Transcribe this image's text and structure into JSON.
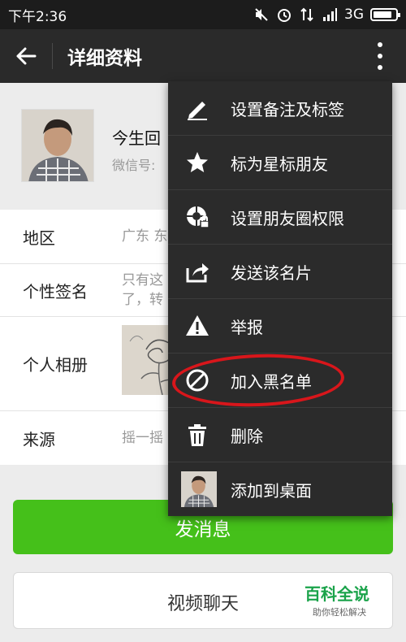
{
  "status_bar": {
    "time": "下午2:36",
    "network": "3G"
  },
  "header": {
    "title": "详细资料"
  },
  "profile": {
    "nickname": "今生回",
    "wechat_id_label": "微信号:"
  },
  "info": [
    {
      "label": "地区",
      "value": "广东  东"
    },
    {
      "label": "个性签名",
      "value_line1": "只有这",
      "value_line2": "了，转"
    },
    {
      "label": "个人相册"
    },
    {
      "label": "来源",
      "value": "摇一摇"
    }
  ],
  "buttons": {
    "send_message": "发消息",
    "video_call": "视频聊天"
  },
  "watermark": {
    "title": "百科全说",
    "subtitle": "助你轻松解决"
  },
  "menu": {
    "items": [
      {
        "label": "设置备注及标签",
        "icon": "pencil-icon"
      },
      {
        "label": "标为星标朋友",
        "icon": "star-icon"
      },
      {
        "label": "设置朋友圈权限",
        "icon": "camera-lock-icon"
      },
      {
        "label": "发送该名片",
        "icon": "share-icon"
      },
      {
        "label": "举报",
        "icon": "warning-icon"
      },
      {
        "label": "加入黑名单",
        "icon": "block-icon"
      },
      {
        "label": "删除",
        "icon": "trash-icon"
      },
      {
        "label": "添加到桌面",
        "icon": "avatar-thumbnail"
      }
    ]
  },
  "colors": {
    "accent_green": "#45c01a",
    "titlebar": "#2a2a2a",
    "menu_bg": "#2b2b2b",
    "annotation_red": "#d8161b",
    "watermark_green": "#1aa34a"
  }
}
